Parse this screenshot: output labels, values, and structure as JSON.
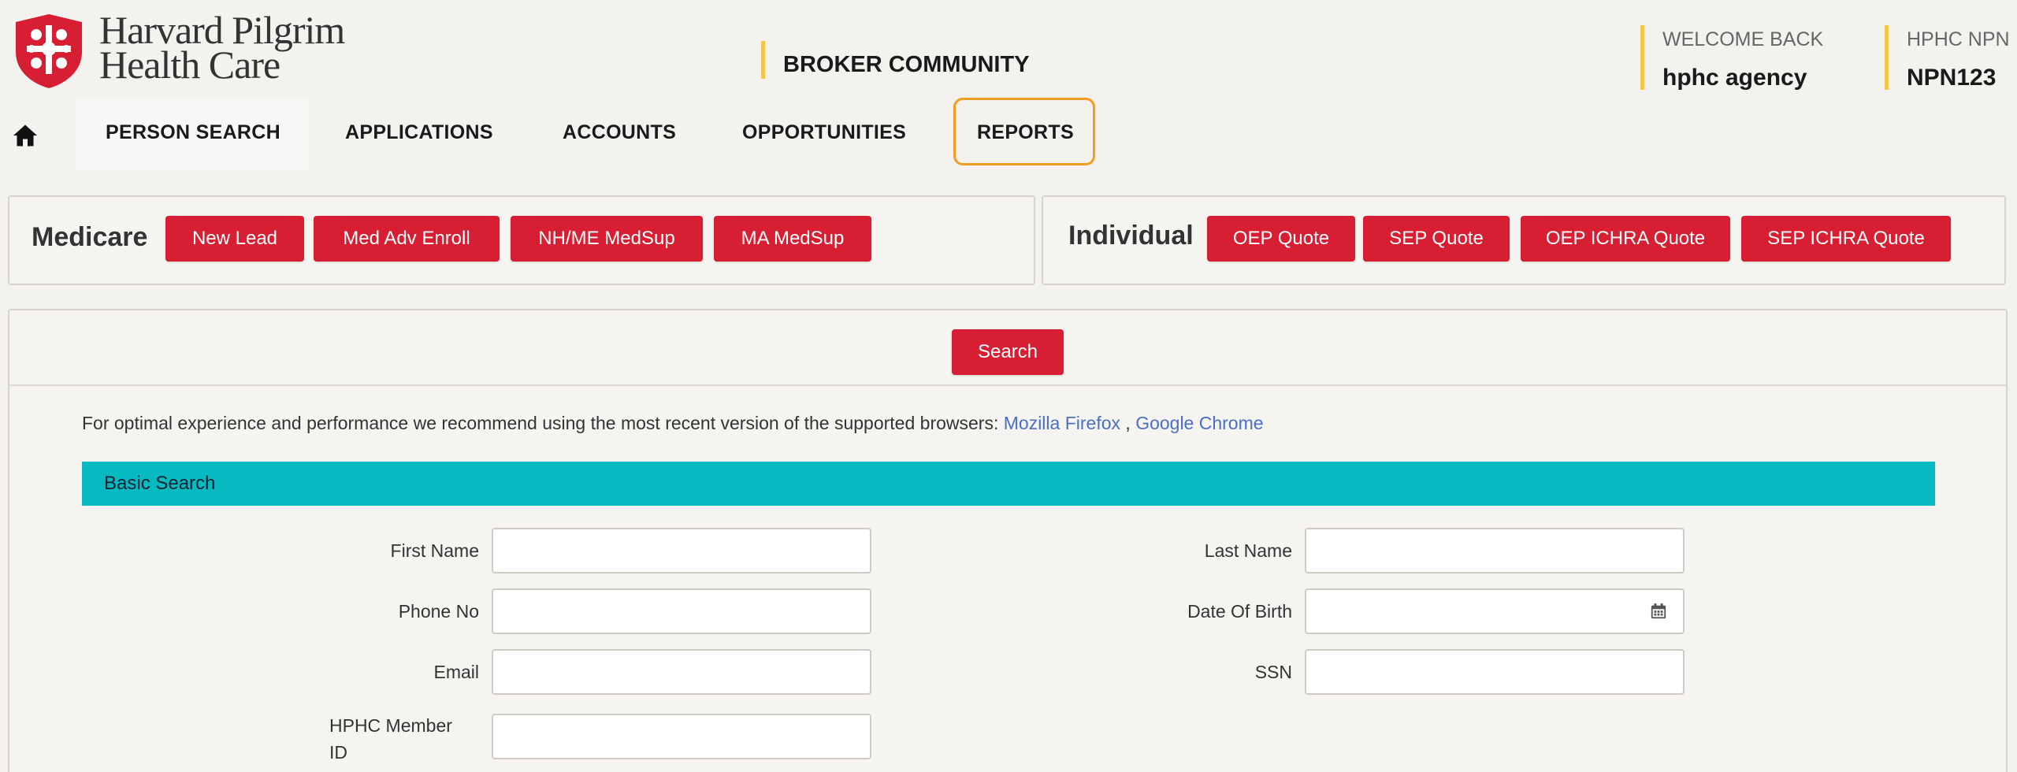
{
  "header": {
    "brand_line1": "Harvard Pilgrim",
    "brand_line2": "Health Care",
    "community": "BROKER COMMUNITY",
    "welcome_label": "WELCOME BACK",
    "welcome_value": "hphc agency",
    "npn_label": "HPHC NPN",
    "npn_value": "NPN123"
  },
  "nav": {
    "items": [
      "PERSON SEARCH",
      "APPLICATIONS",
      "ACCOUNTS",
      "OPPORTUNITIES",
      "REPORTS"
    ]
  },
  "medicare": {
    "title": "Medicare",
    "buttons": [
      "New Lead",
      "Med Adv Enroll",
      "NH/ME MedSup",
      "MA MedSup"
    ]
  },
  "individual": {
    "title": "Individual",
    "buttons": [
      "OEP Quote",
      "SEP Quote",
      "OEP ICHRA Quote",
      "SEP ICHRA Quote"
    ]
  },
  "search": {
    "button_label": "Search",
    "notice_text": "For optimal experience and performance we recommend using the most recent version of the supported browsers: ",
    "link_firefox": "Mozilla Firefox",
    "link_sep": " , ",
    "link_chrome": "Google Chrome",
    "section_title": "Basic Search",
    "fields": {
      "first_name": "First Name",
      "last_name": "Last Name",
      "phone": "Phone No",
      "dob": "Date Of Birth",
      "email": "Email",
      "ssn": "SSN",
      "member_id_line1": "HPHC Member",
      "member_id_line2": "ID"
    }
  },
  "colors": {
    "brand_red": "#d71e32",
    "accent_yellow": "#f3c54a",
    "teal": "#07b9c1",
    "highlight_orange": "#f39c1f",
    "link_blue": "#4a6fc7"
  },
  "icons": [
    "hphc-logo-icon",
    "home-icon",
    "calendar-icon"
  ]
}
